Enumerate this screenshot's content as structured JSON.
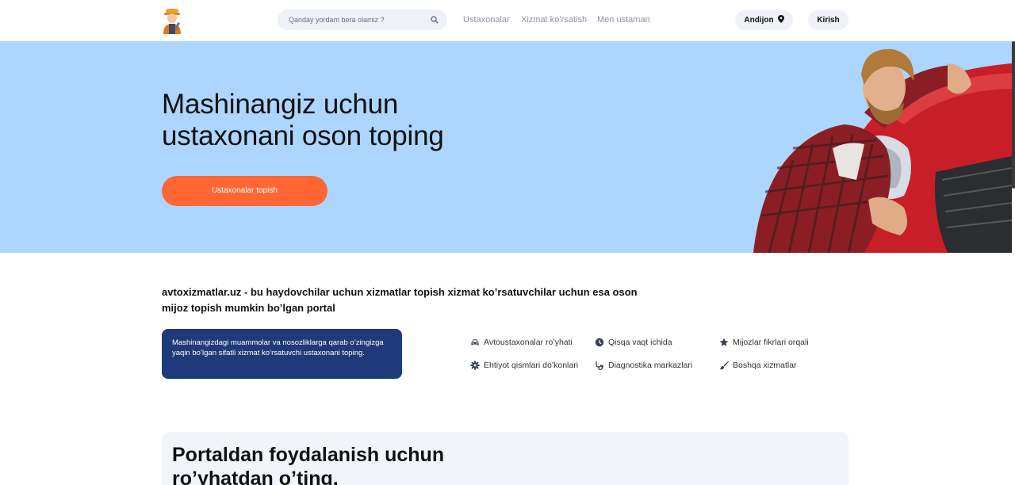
{
  "header": {
    "search_placeholder": "Qanday yordam bera olamiz ?",
    "nav": [
      "Ustaxonalar",
      "Xizmat ko’rsatish",
      "Men ustaman"
    ],
    "city": "Andijon",
    "login": "Kirish"
  },
  "hero": {
    "title": "Mashinangiz uchun ustaxonani oson toping",
    "button": "Ustaxonalar topish"
  },
  "intro": {
    "text": "avtoxizmatlar.uz - bu haydovchilar uchun xizmatlar topish xizmat ko’rsatuvchilar uchun esa oson mijoz topish mumkin bo’lgan portal",
    "card": "Mashinangizdagi muammolar va nosozliklarga qarab o’zingizga yaqin bo’lgan sifatli xizmat ko’rsatuvchi ustaxonani toping."
  },
  "features": [
    {
      "label": "Avtoustaxonalar ro’yhati",
      "icon": "car-icon"
    },
    {
      "label": "Qisqa vaqt ichida",
      "icon": "clock-icon"
    },
    {
      "label": "Mijozlar fikrlari orqali",
      "icon": "star-icon"
    },
    {
      "label": "Ehtiyot qismlari do’konlari",
      "icon": "gear-icon"
    },
    {
      "label": "Diagnostika markazlari",
      "icon": "stethoscope-icon"
    },
    {
      "label": "Boshqa xizmatlar",
      "icon": "brush-icon"
    }
  ],
  "register": {
    "title": "Portaldan foydalanish uchun ro’yhatdan o’ting."
  },
  "colors": {
    "hero_bg": "#add6fe",
    "accent": "#ff6633",
    "card_bg": "#1f3a7a",
    "panel_bg": "#f1f5f9"
  }
}
